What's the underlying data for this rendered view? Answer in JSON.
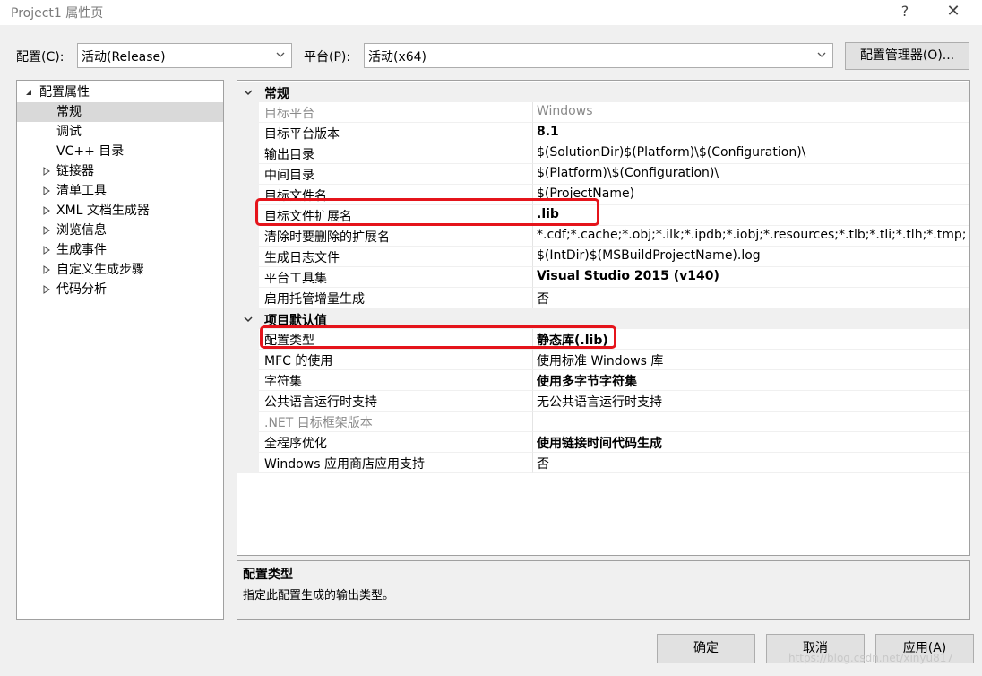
{
  "window": {
    "title": "Project1 属性页",
    "help_glyph": "?",
    "close_glyph": "✕"
  },
  "config": {
    "label": "配置(C):",
    "value": "活动(Release)",
    "platform_label": "平台(P):",
    "platform_value": "活动(x64)",
    "manager_button": "配置管理器(O)..."
  },
  "tree": {
    "root": "配置属性",
    "items": [
      {
        "label": "常规"
      },
      {
        "label": "调试"
      },
      {
        "label": "VC++ 目录"
      },
      {
        "label": "链接器"
      },
      {
        "label": "清单工具"
      },
      {
        "label": "XML 文档生成器"
      },
      {
        "label": "浏览信息"
      },
      {
        "label": "生成事件"
      },
      {
        "label": "自定义生成步骤"
      },
      {
        "label": "代码分析"
      }
    ]
  },
  "grid": {
    "categories": [
      {
        "label": "常规",
        "rows": [
          {
            "name": "目标平台",
            "value": "Windows"
          },
          {
            "name": "目标平台版本",
            "value": "8.1"
          },
          {
            "name": "输出目录",
            "value": "$(SolutionDir)$(Platform)\\$(Configuration)\\"
          },
          {
            "name": "中间目录",
            "value": "$(Platform)\\$(Configuration)\\"
          },
          {
            "name": "目标文件名",
            "value": "$(ProjectName)"
          },
          {
            "name": "目标文件扩展名",
            "value": ".lib"
          },
          {
            "name": "清除时要删除的扩展名",
            "value": "*.cdf;*.cache;*.obj;*.ilk;*.ipdb;*.iobj;*.resources;*.tlb;*.tli;*.tlh;*.tmp;"
          },
          {
            "name": "生成日志文件",
            "value": "$(IntDir)$(MSBuildProjectName).log"
          },
          {
            "name": "平台工具集",
            "value": "Visual Studio 2015 (v140)"
          },
          {
            "name": "启用托管增量生成",
            "value": "否"
          }
        ]
      },
      {
        "label": "项目默认值",
        "rows": [
          {
            "name": "配置类型",
            "value": "静态库(.lib)"
          },
          {
            "name": "MFC 的使用",
            "value": "使用标准 Windows 库"
          },
          {
            "name": "字符集",
            "value": "使用多字节字符集"
          },
          {
            "name": "公共语言运行时支持",
            "value": "无公共语言运行时支持"
          },
          {
            "name": ".NET 目标框架版本",
            "value": ""
          },
          {
            "name": "全程序优化",
            "value": "使用链接时间代码生成"
          },
          {
            "name": "Windows 应用商店应用支持",
            "value": "否"
          }
        ]
      }
    ]
  },
  "description": {
    "title": "配置类型",
    "text": "指定此配置生成的输出类型。"
  },
  "buttons": {
    "ok": "确定",
    "cancel": "取消",
    "apply": "应用(A)"
  },
  "watermark": "https://blog.csdn.net/xinyu817",
  "colors": {
    "highlight": "#e5141b",
    "selection": "#d9d9d9"
  }
}
